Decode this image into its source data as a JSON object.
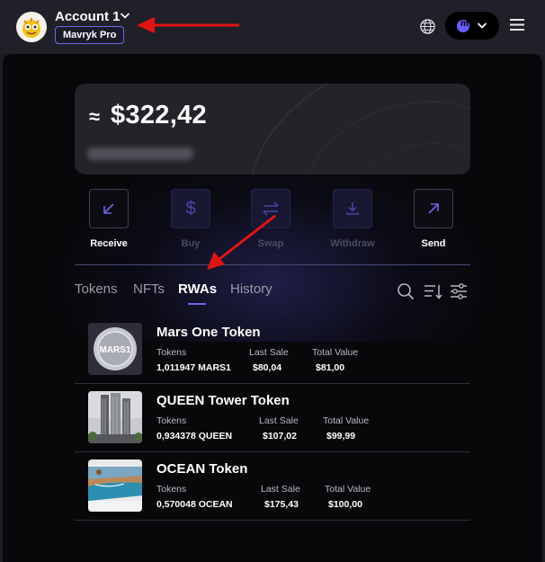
{
  "header": {
    "account_name": "Account 1",
    "plan_badge": "Mavryk Pro",
    "network_badge_letter": "m",
    "accent": "#6e67e8"
  },
  "balance": {
    "approx_symbol": "≈",
    "amount": "$322,42"
  },
  "actions": [
    {
      "label": "Receive",
      "icon": "arrow-down-left-icon",
      "enabled": true
    },
    {
      "label": "Buy",
      "icon": "dollar-icon",
      "enabled": false
    },
    {
      "label": "Swap",
      "icon": "swap-icon",
      "enabled": false
    },
    {
      "label": "Withdraw",
      "icon": "download-icon",
      "enabled": false
    },
    {
      "label": "Send",
      "icon": "arrow-up-right-icon",
      "enabled": true
    }
  ],
  "tabs": [
    {
      "label": "Tokens",
      "active": false
    },
    {
      "label": "NFTs",
      "active": false
    },
    {
      "label": "RWAs",
      "active": true
    },
    {
      "label": "History",
      "active": false
    }
  ],
  "tokens": [
    {
      "name": "Mars One Token",
      "thumb_label": "MARS1",
      "tokens_header": "Tokens",
      "tokens_value": "1,011947 MARS1",
      "last_sale_header": "Last Sale",
      "last_sale_value": "$80,04",
      "total_value_header": "Total Value",
      "total_value_value": "$81,00"
    },
    {
      "name": "QUEEN Tower Token",
      "tokens_header": "Tokens",
      "tokens_value": "0,934378 QUEEN",
      "last_sale_header": "Last Sale",
      "last_sale_value": "$107,02",
      "total_value_header": "Total Value",
      "total_value_value": "$99,99"
    },
    {
      "name": "OCEAN Token",
      "tokens_header": "Tokens",
      "tokens_value": "0,570048 OCEAN",
      "last_sale_header": "Last Sale",
      "last_sale_value": "$175,43",
      "total_value_header": "Total Value",
      "total_value_value": "$100,00"
    }
  ]
}
